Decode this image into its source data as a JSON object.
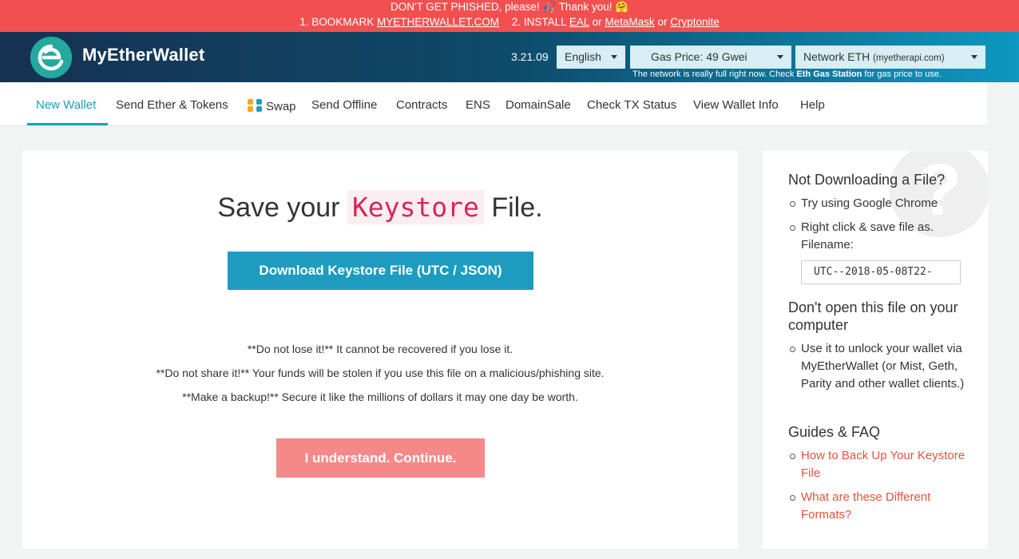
{
  "banner": {
    "line1": "DON'T GET PHISHED, please! 🎣 Thank you! 🤗",
    "bookmark_prefix": "1. BOOKMARK ",
    "bookmark_link": "MYETHERWALLET.COM",
    "install_prefix": "2. INSTALL ",
    "eal": "EAL",
    "or1": " or ",
    "metamask": "MetaMask",
    "or2": " or ",
    "cryptonite": "Cryptonite"
  },
  "header": {
    "brand": "MyEtherWallet",
    "version": "3.21.09",
    "language": "English",
    "gas_price": "Gas Price: 49 Gwei",
    "network_label": "Network ETH",
    "network_host": "(myetherapi.com)",
    "network_note_pre": "The network is really full right now. Check ",
    "network_note_link": "Eth Gas Station",
    "network_note_post": " for gas price to use."
  },
  "nav": {
    "items": [
      {
        "label": "New Wallet"
      },
      {
        "label": "Send Ether & Tokens"
      },
      {
        "label": "Swap"
      },
      {
        "label": "Send Offline"
      },
      {
        "label": "Contracts"
      },
      {
        "label": "ENS"
      },
      {
        "label": "DomainSale"
      },
      {
        "label": "Check TX Status"
      },
      {
        "label": "View Wallet Info"
      },
      {
        "label": "Help"
      }
    ]
  },
  "main": {
    "title_pre": "Save your ",
    "title_code": "Keystore",
    "title_post": " File.",
    "download_button": "Download Keystore File (UTC / JSON)",
    "warnings": [
      "**Do not lose it!** It cannot be recovered if you lose it.",
      "**Do not share it!** Your funds will be stolen if you use this file on a malicious/phishing site.",
      "**Make a backup!** Secure it like the millions of dollars it may one day be worth."
    ],
    "continue_button": "I understand. Continue."
  },
  "side": {
    "qmark": "?",
    "h1": "Not Downloading a File?",
    "li1": "Try using Google Chrome",
    "li2": "Right click & save file as. Filename:",
    "filename": "UTC--2018-05-08T22-",
    "h2": "Don't open this file on your computer",
    "li3": "Use it to unlock your wallet via MyEtherWallet (or Mist, Geth, Parity and other wallet clients.)",
    "h3": "Guides & FAQ",
    "link1": "How to Back Up Your Keystore File",
    "link2": "What are these Different Formats?"
  }
}
